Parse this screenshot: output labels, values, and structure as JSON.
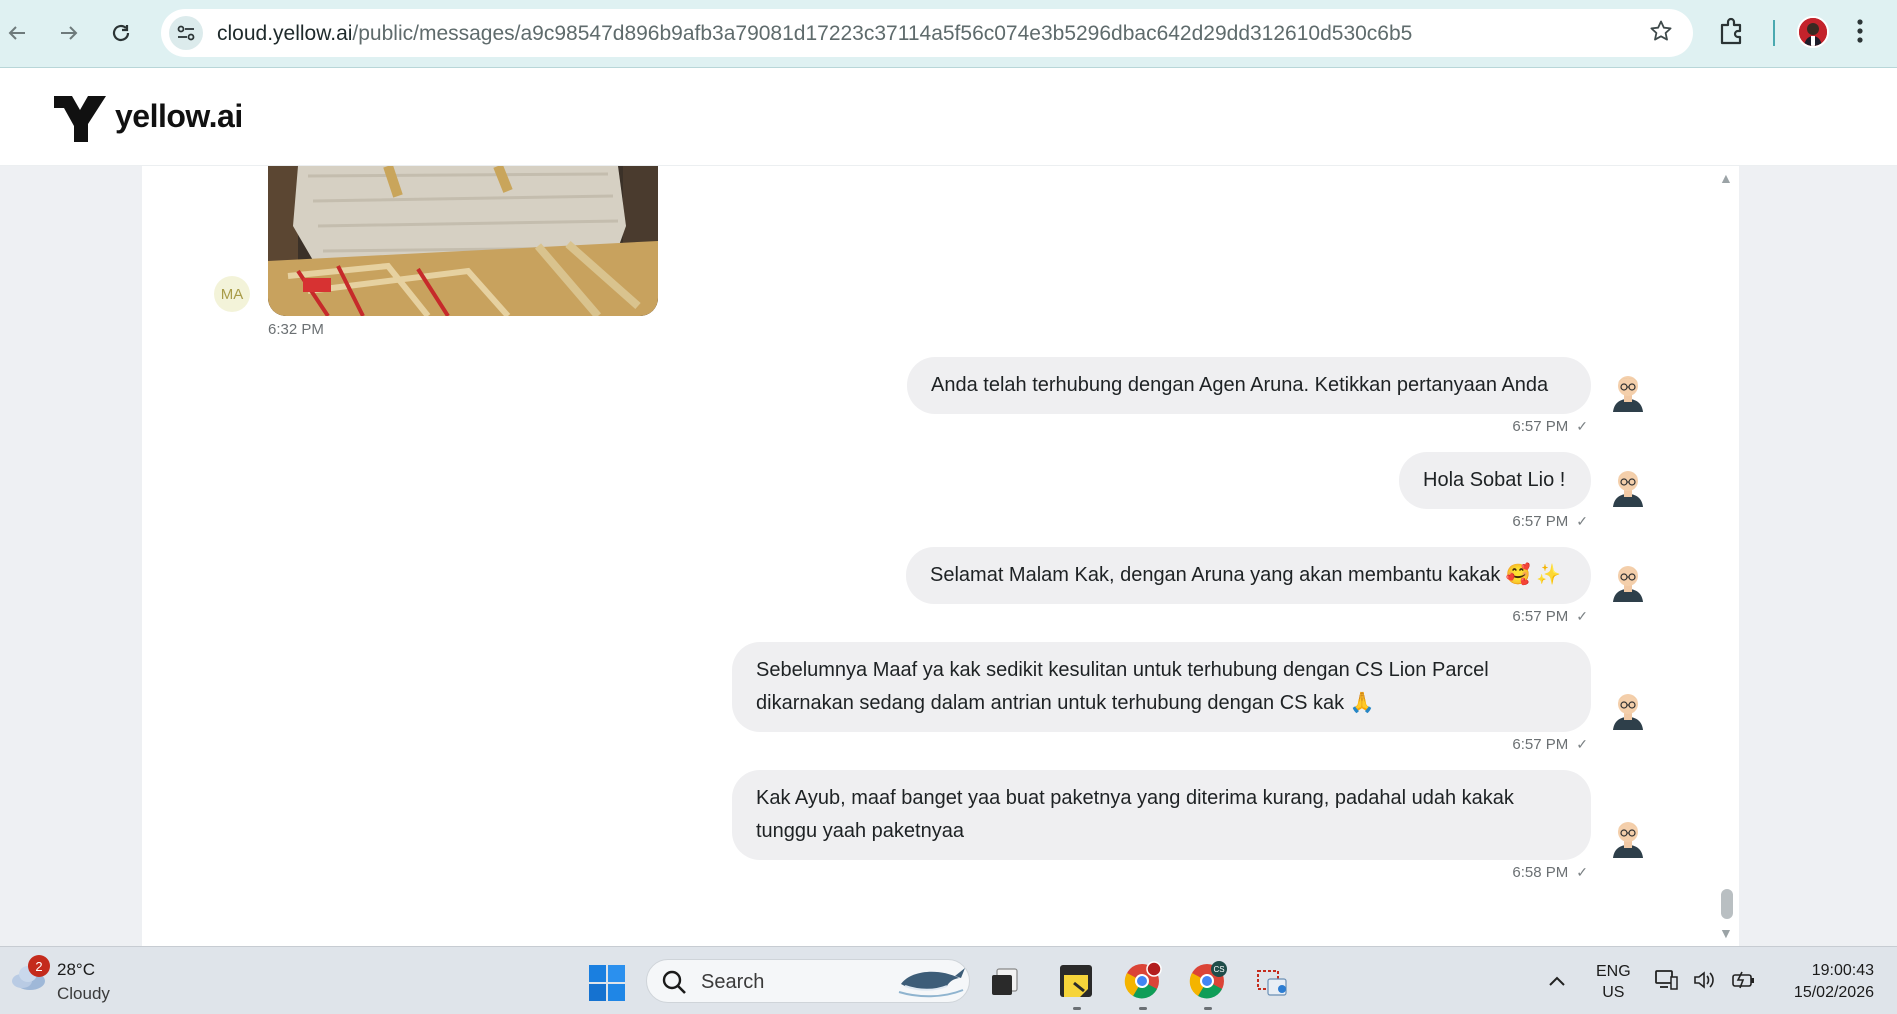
{
  "browser": {
    "url_host": "cloud.yellow.ai",
    "url_path": "/public/messages/a9c98547d896b9afb3a79081d17223c37114a5f56c074e3b5296dbac642d29dd312610d530c6b5",
    "icons": [
      "back-arrow-icon",
      "forward-arrow-icon",
      "reload-icon",
      "site-settings-icon",
      "star-icon",
      "extensions-icon",
      "profile-avatar",
      "more-menu-icon"
    ]
  },
  "header": {
    "logo_text": "yellow.ai"
  },
  "incoming": {
    "avatar_initials": "MA",
    "time": "6:32 PM"
  },
  "messages": [
    {
      "text": "Anda telah terhubung dengan Agen Aruna. Ketikkan pertanyaan Anda",
      "time": "6:57 PM"
    },
    {
      "text": "Hola Sobat Lio !",
      "time": "6:57 PM"
    },
    {
      "text": "Selamat Malam Kak, dengan Aruna yang akan membantu kakak 🥰 ✨",
      "time": "6:57 PM"
    },
    {
      "text": "Sebelumnya Maaf ya kak sedikit kesulitan untuk terhubung dengan CS Lion Parcel dikarnakan sedang dalam antrian untuk terhubung dengan CS kak 🙏",
      "time": "6:57 PM"
    },
    {
      "text": "Kak Ayub, maaf banget yaa buat paketnya yang diterima kurang, padahal udah kakak tunggu yaah paketnyaa",
      "time": "6:58 PM"
    }
  ],
  "taskbar": {
    "weather_badge": "2",
    "weather_temp": "28°C",
    "weather_desc": "Cloudy",
    "search_label": "Search",
    "lang_top": "ENG",
    "lang_bottom": "US",
    "clock_time": "19:00:43",
    "clock_date": "15/02/2026",
    "chrome_badge": "CS"
  }
}
